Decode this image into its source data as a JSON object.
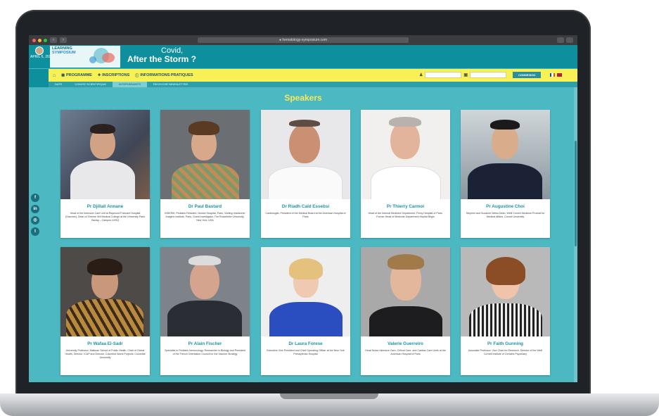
{
  "browser": {
    "url": "● hematology-symposium.com",
    "nav_back": "‹",
    "nav_forward": "›"
  },
  "header": {
    "date": "APRIL 6, 2021",
    "logo_line1": "LEARNING",
    "logo_line2": "SYMPOSIUM",
    "covid_line1": "Covid,",
    "covid_line2": "After the Storm ?"
  },
  "nav": {
    "home_icon": "home-icon",
    "items": [
      {
        "label": "PROGRAMME"
      },
      {
        "label": "INSCRIPTIONS"
      },
      {
        "label": "INFORMATIONS PRATIQUES"
      }
    ],
    "connect_label": "CONNEXION"
  },
  "subnav": {
    "tabs": [
      "DATE",
      "COMITE SCIENTIFIQUE",
      "INTERVENANTS",
      "RECEVOIR NEWSLETTER"
    ]
  },
  "page": {
    "title": "Speakers",
    "title_color": "#f7e95a"
  },
  "colors": {
    "background": "#4cb8c2",
    "nav": "#f8f155",
    "header": "#0d8f9e",
    "speaker_name": "#1e91a8"
  },
  "social": [
    "f",
    "in",
    "◎",
    "t"
  ],
  "speakers": [
    {
      "name": "Pr Djillali Annane",
      "bio": "Head of the Intensive Care Unit at Raymond Poincare Hospital (Garches), Dean of Simone Veil Medical College at the University Paris Saclay – Campus UVSQ"
    },
    {
      "name": "Dr Paul Bastard",
      "bio": "INSERM, Pediatric Resident, Necker Hospital, Paris, Visiting researcher Imagine Institute, Paris, Guest investigator, The Rockefeller University, New York, USA"
    },
    {
      "name": "Dr Riadh Caïd Essebsi",
      "bio": "Cardiologist, President of the Medical Board at the American Hospital of Paris"
    },
    {
      "name": "Pr Thierry Carmoi",
      "bio": "Head of the Internal Medicine Department, Percy Hospital of Paris, Former Head of Medicine Department Hôpital Bégin"
    },
    {
      "name": "Pr Augustine Choi",
      "bio": "Stephen and Suzanne Weiss Dean, Weill Cornell Medicine Provost for Medical Affairs, Cornell University"
    },
    {
      "name": "Pr Wafaa El-Sadr",
      "bio": "University Professor, Mailman School of Public Health, Chair of Global Health, Director, ICAP and Director, Columbia World Projects, Columbia University"
    },
    {
      "name": "Pr Alain Fischer",
      "bio": "Specialist in Pediatric Immunology, Researcher in Biology and President of the French Orientation Council for the Vaccine Strategy"
    },
    {
      "name": "Dr Laura Forese",
      "bio": "Executive Vice President and Chief Operating Officer at the New York Presbyterian Hospital"
    },
    {
      "name": "Valerie Guerreiro",
      "bio": "Head Nurse Intensive Care, Critical Care, and Cardiac Care Units at the American Hospital of Paris"
    },
    {
      "name": "Pr Faith Gunning",
      "bio": "Associate Professor, Vice Chair for Research, Director of the Weill Cornell Institute of Geriatric Psychiatry"
    }
  ]
}
